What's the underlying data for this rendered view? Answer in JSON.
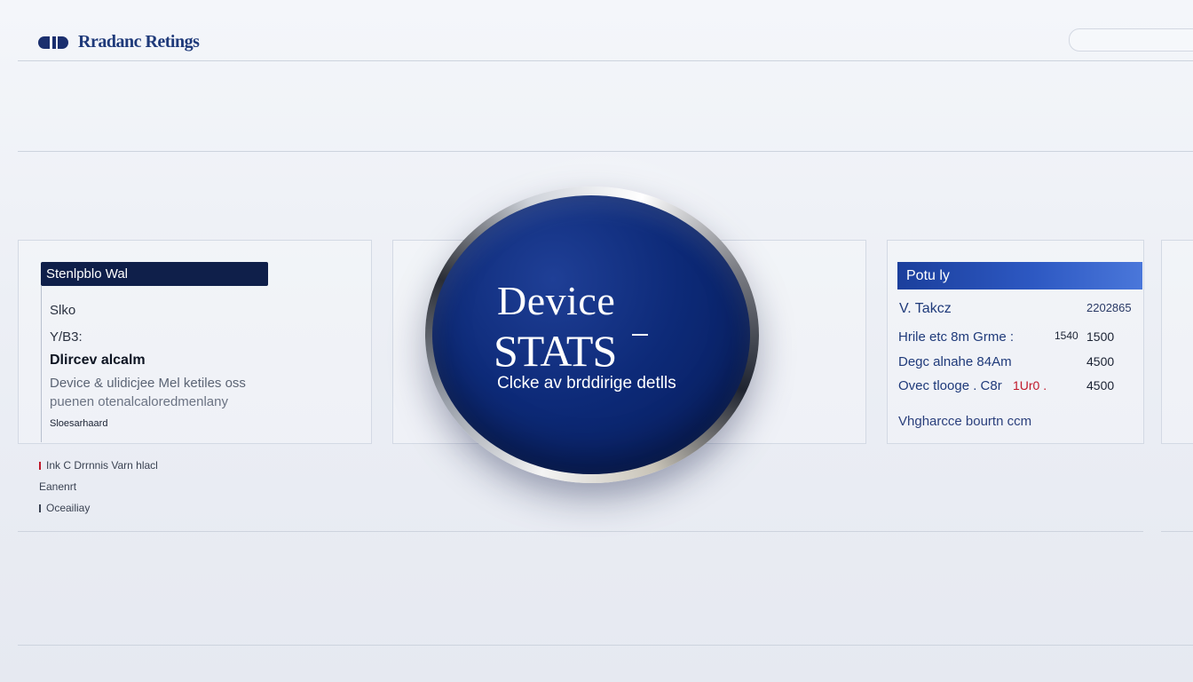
{
  "header": {
    "brand_name": "Rradanc Retings",
    "logo_icon": "brand-logo-icon"
  },
  "left_panel": {
    "title": "Stenlpblo Wal",
    "lines": [
      "Slko",
      "Y/B3:",
      "Dlircev alcalm",
      "Device & ulidicjee Mel ketiles oss",
      "puenen otenalcaloredmenlany",
      "Sloesarhaard"
    ]
  },
  "bottom_links": [
    {
      "label": "Ink  C Drrnnis Varn hlacl",
      "marker_color": "#c0182a"
    },
    {
      "label": "Eanenrt",
      "marker_color": "#3a4252"
    },
    {
      "label": "Oceailiay",
      "marker_color": "#3a4252"
    }
  ],
  "center_oval": {
    "title_line1": "Device",
    "title_line2": "STATS",
    "subtitle": "Clcke av brddirige detlls",
    "accent": "#0d2a78"
  },
  "right_panel": {
    "title": "Potu ly",
    "header_left": "V. Takcz",
    "header_right": "2202865",
    "rows": [
      {
        "label": "Hrile etc 8m Grme :",
        "extra": "1540",
        "value": "1500"
      },
      {
        "label": "Degc alnahe 84Am",
        "extra": "",
        "value": "4500"
      },
      {
        "label": "Ovec tlooge . C8r",
        "extra": "1Ur0 .",
        "value": "4500"
      }
    ],
    "footer": "Vhgharcce bourtn ccm",
    "accent": "#2d58c2",
    "alert_color": "#c0182a"
  }
}
